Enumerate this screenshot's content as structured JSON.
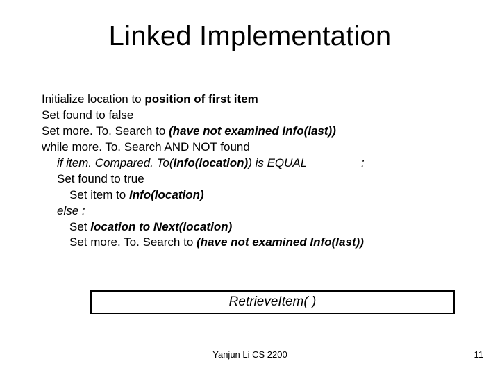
{
  "title": "Linked Implementation",
  "lines": {
    "l1a": "Initialize location to ",
    "l1b": "position of first item",
    "l2": "Set found to false",
    "l3a": "Set more. To. Search to ",
    "l3b": "(have not examined Info(last))",
    "l4": "while more. To. Search AND NOT found",
    "l5a": "if item. Compared. To(",
    "l5b": "Info(location)",
    "l5c": ") is EQUAL",
    "l5colon": ":",
    "l6": "Set found to true",
    "l7a": "Set item to ",
    "l7b": "Info(location)",
    "l8": "else :",
    "l9a": "Set ",
    "l9b": "location to Next(location)",
    "l10a": "Set more. To. Search to ",
    "l10b": "(have not examined Info(last))"
  },
  "box_label": "RetrieveItem( )",
  "footer_center": "Yanjun Li CS 2200",
  "footer_right": "11"
}
